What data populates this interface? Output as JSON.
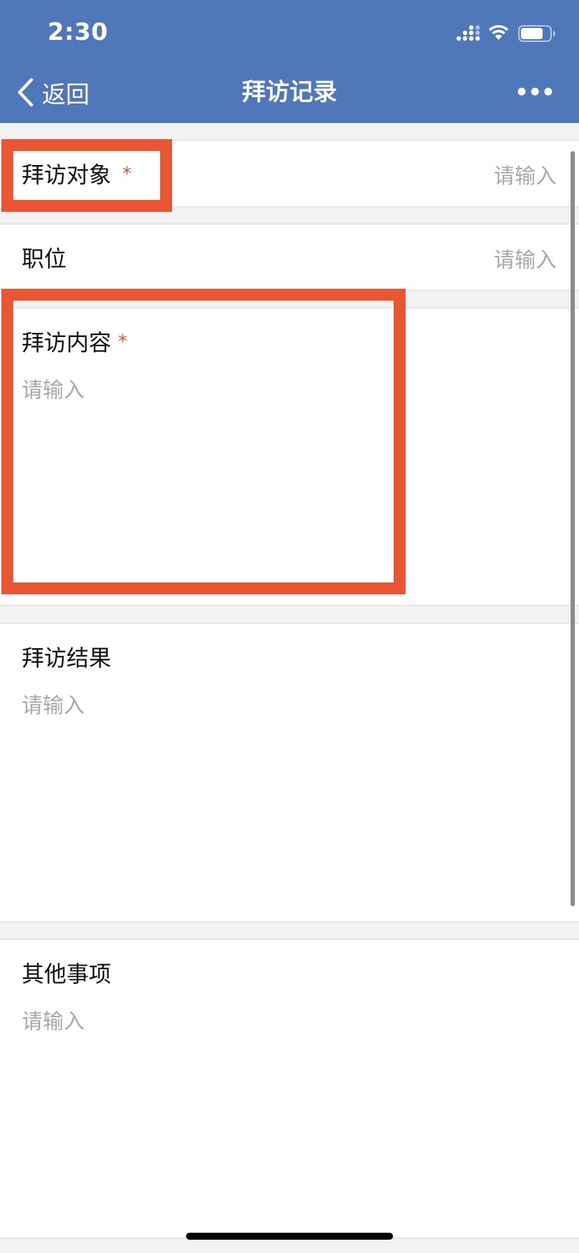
{
  "status_bar": {
    "time": "2:30"
  },
  "nav": {
    "back_label": "返回",
    "title": "拜访记录"
  },
  "form": {
    "visit_target": {
      "label": "拜访对象",
      "required_mark": "*",
      "placeholder": "请输入"
    },
    "position": {
      "label": "职位",
      "placeholder": "请输入"
    },
    "visit_content": {
      "label": "拜访内容",
      "required_mark": "*",
      "placeholder": "请输入"
    },
    "visit_result": {
      "label": "拜访结果",
      "placeholder": "请输入"
    },
    "other_items": {
      "label": "其他事项",
      "placeholder": "请输入"
    }
  },
  "colors": {
    "header_bg": "#4f77b9",
    "required": "#d9533a",
    "highlight": "#ea5633",
    "placeholder": "#a8a8a8"
  }
}
